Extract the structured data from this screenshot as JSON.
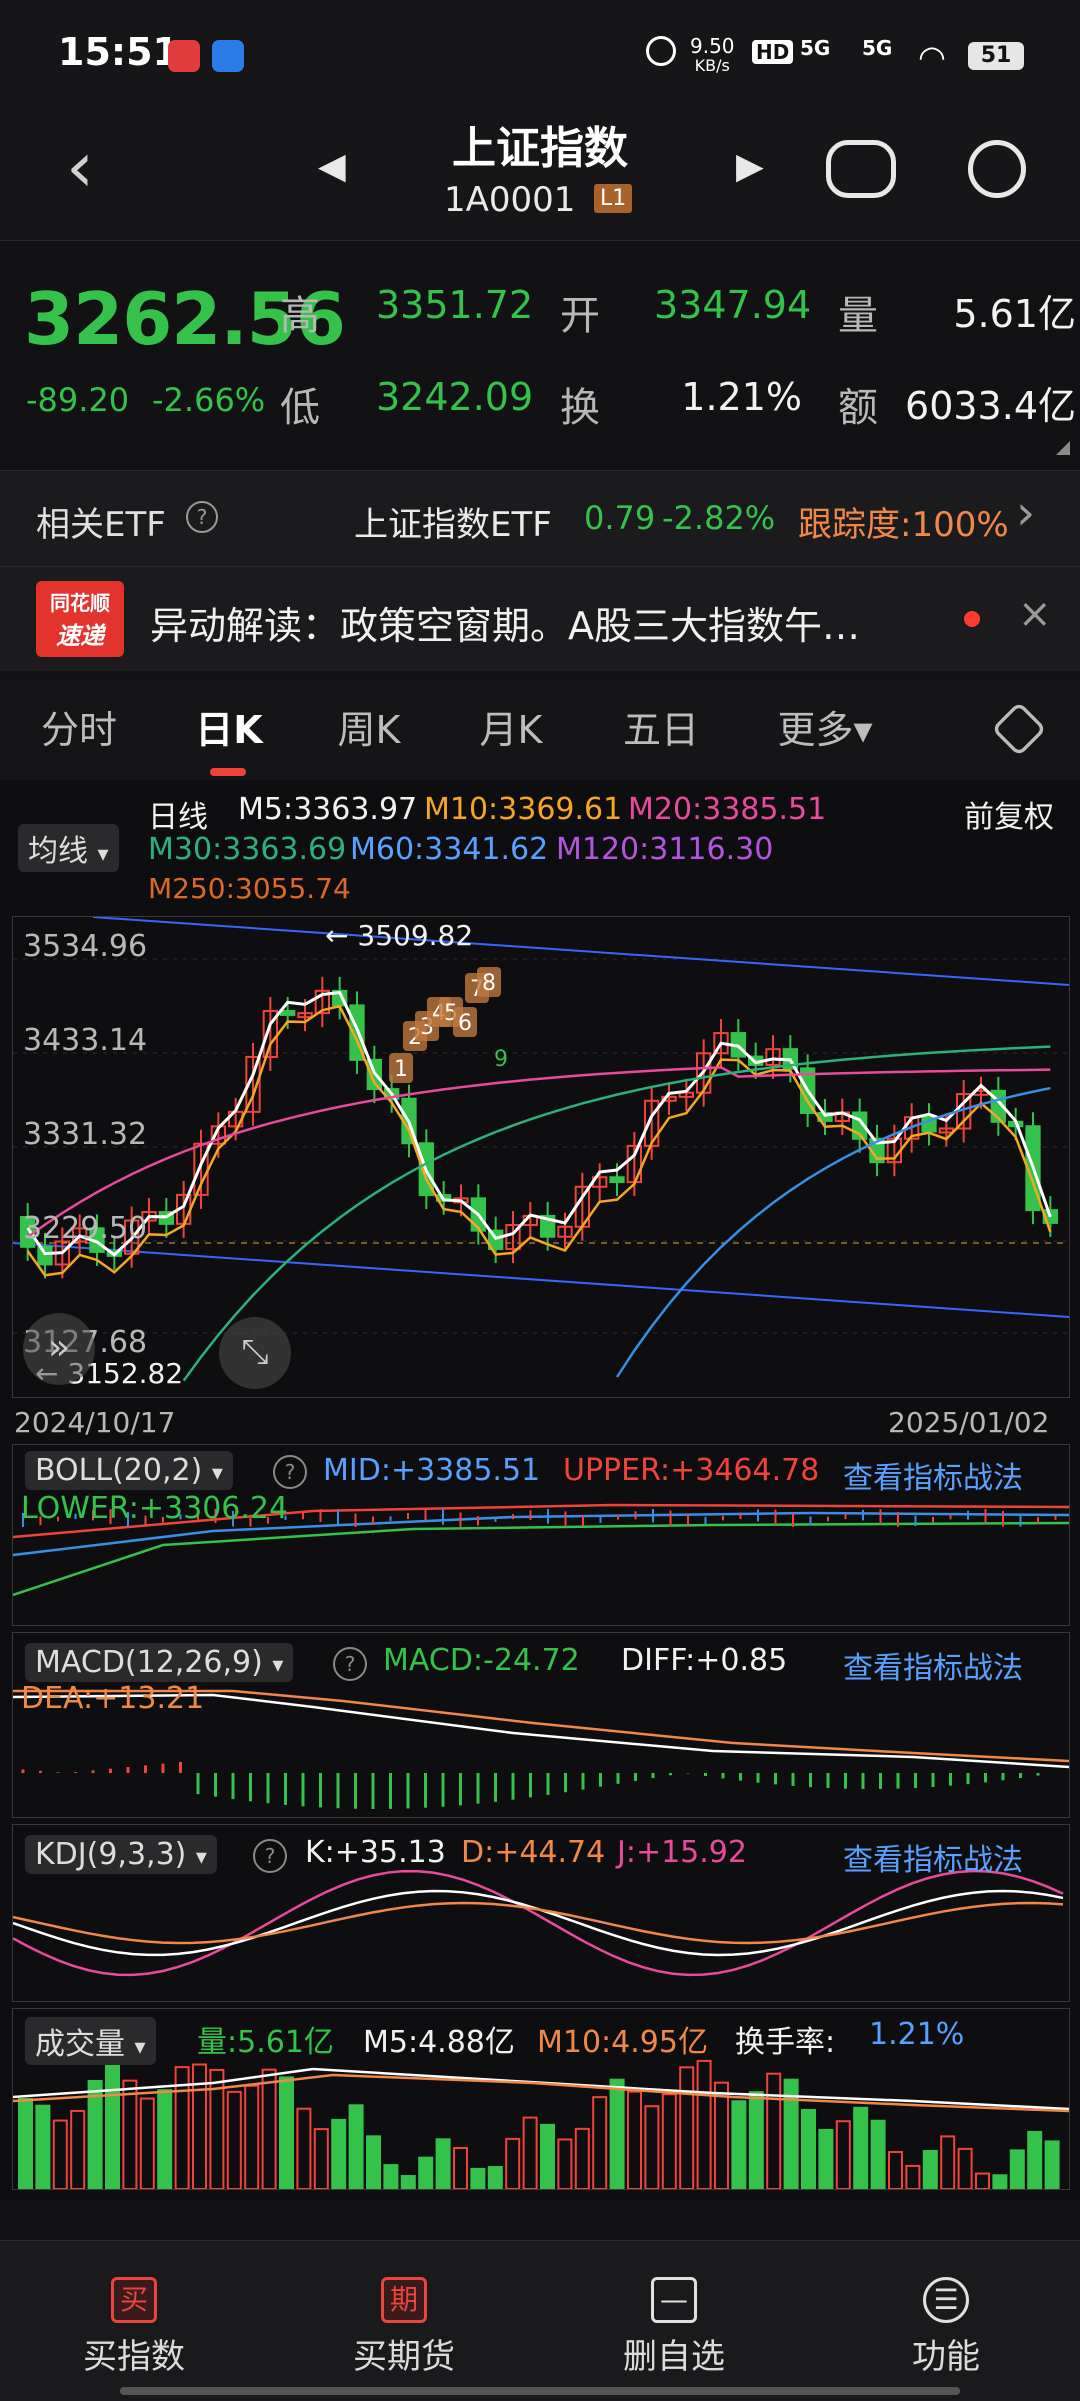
{
  "status_bar": {
    "time": "15:51",
    "net_speed": "9.50",
    "net_unit": "KB/s",
    "battery": "51",
    "hd": "HD",
    "signal1": "5G",
    "signal2": "5G"
  },
  "header": {
    "title": "上证指数",
    "code": "1A0001",
    "level": "L1"
  },
  "quote": {
    "price": "3262.56",
    "change": "-89.20",
    "change_pct": "-2.66%",
    "high_label": "高",
    "high": "3351.72",
    "open_label": "开",
    "open": "3347.94",
    "volume_label": "量",
    "volume": "5.61亿",
    "low_label": "低",
    "low": "3242.09",
    "turnover_label": "换",
    "turnover": "1.21%",
    "amount_label": "额",
    "amount": "6033.4亿"
  },
  "etf": {
    "label": "相关ETF",
    "name": "上证指数ETF",
    "price": "0.79",
    "pct": "-2.82%",
    "track": "跟踪度:100%"
  },
  "news": {
    "logo_top": "同花顺",
    "logo_bottom": "速递",
    "text": "异动解读：政策空窗期。A股三大指数午…"
  },
  "tabs": [
    "分时",
    "日K",
    "周K",
    "月K",
    "五日",
    "更多▾"
  ],
  "kline": {
    "period": "日线",
    "adjust": "前复权",
    "ma_selector": "均线",
    "ma5": "M5:3363.97",
    "ma10": "M10:3369.61",
    "ma20": "M20:3385.51",
    "ma30": "M30:3363.69",
    "ma60": "M60:3341.62",
    "ma120": "M120:3116.30",
    "ma250": "M250:3055.74",
    "y_ticks": [
      "3534.96",
      "3433.14",
      "3331.32",
      "3229.50",
      "3127.68"
    ],
    "high_mark": "3509.82",
    "low_mark": "3152.82",
    "date_start": "2024/10/17",
    "date_end": "2025/01/02",
    "signals": [
      "1",
      "2",
      "3",
      "4",
      "5",
      "6",
      "7",
      "8",
      "9"
    ]
  },
  "boll": {
    "name": "BOLL(20,2)",
    "mid": "MID:+3385.51",
    "upper": "UPPER:+3464.78",
    "lower": "LOWER:+3306.24",
    "link": "查看指标战法"
  },
  "macd": {
    "name": "MACD(12,26,9)",
    "macd": "MACD:-24.72",
    "diff": "DIFF:+0.85",
    "dea": "DEA:+13.21",
    "link": "查看指标战法"
  },
  "kdj": {
    "name": "KDJ(9,3,3)",
    "k": "K:+35.13",
    "d": "D:+44.74",
    "j": "J:+15.92",
    "link": "查看指标战法"
  },
  "vol": {
    "name": "成交量",
    "vol": "量:5.61亿",
    "m5": "M5:4.88亿",
    "m10": "M10:4.95亿",
    "turnover_label": "换手率:",
    "turnover": "1.21%"
  },
  "bottom_nav": [
    {
      "icon": "买",
      "label": "买指数"
    },
    {
      "icon": "期",
      "label": "买期货"
    },
    {
      "icon": "—",
      "label": "删自选"
    },
    {
      "icon": "☰",
      "label": "功能"
    }
  ],
  "colors": {
    "up": "#f0443b",
    "down": "#34c24a",
    "accent": "#f0884a",
    "link": "#5aa0ff"
  }
}
